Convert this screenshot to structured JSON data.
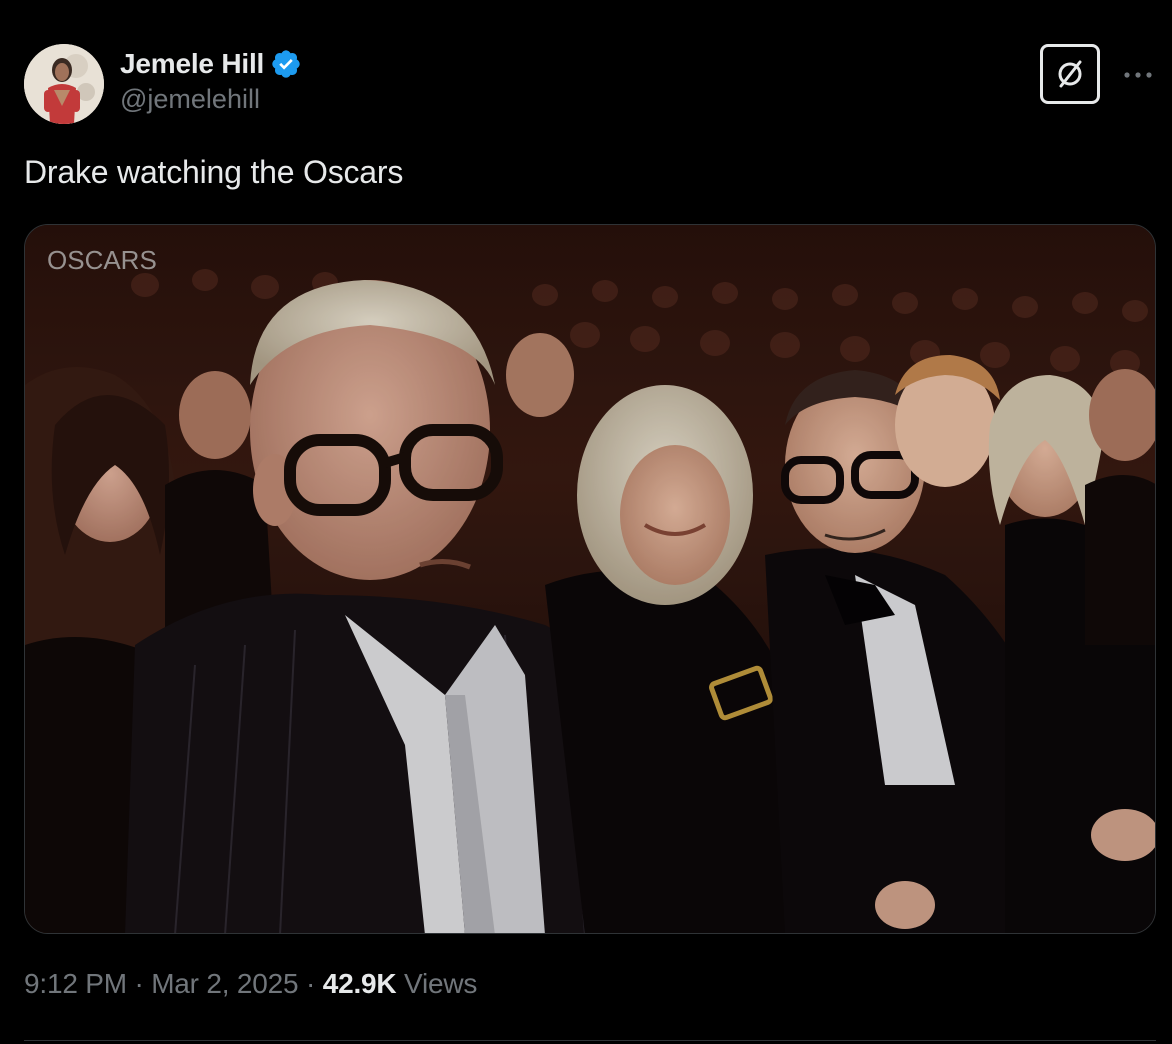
{
  "author": {
    "display_name": "Jemele Hill",
    "handle": "@jemelehill",
    "verified": true,
    "verified_badge_color": "#1d9bf0"
  },
  "actions": {
    "grok_icon": "grok-icon",
    "more_icon": "more-icon",
    "more_label": "···"
  },
  "tweet": {
    "text": "Drake watching the Oscars"
  },
  "media": {
    "watermark": "OSCARS",
    "image_subject": "audience-photo"
  },
  "meta": {
    "time": "9:12 PM",
    "separator": " · ",
    "date": "Mar 2, 2025",
    "views_count": "42.9K",
    "views_label": "Views"
  },
  "colors": {
    "background": "#000000",
    "primary_text": "#e7e9ea",
    "secondary_text": "#71767b",
    "border": "#2f3336"
  }
}
